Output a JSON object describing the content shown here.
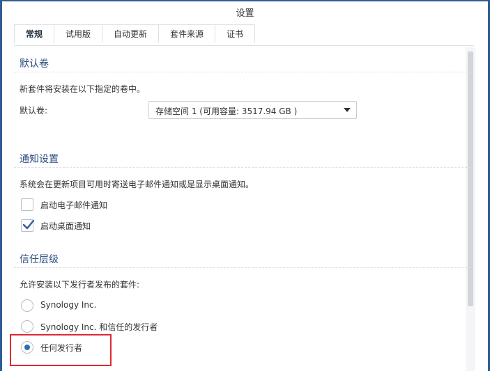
{
  "dialog": {
    "title": "设置"
  },
  "tabs": [
    {
      "label": "常规",
      "active": true
    },
    {
      "label": "试用版",
      "active": false
    },
    {
      "label": "自动更新",
      "active": false
    },
    {
      "label": "套件来源",
      "active": false
    },
    {
      "label": "证书",
      "active": false
    }
  ],
  "default_volume": {
    "section_title": "默认卷",
    "description": "新套件将安装在以下指定的卷中。",
    "field_label": "默认卷:",
    "selected_value": "存储空间 1 (可用容量:  3517.94 GB )"
  },
  "notifications": {
    "section_title": "通知设置",
    "description": "系统会在更新项目可用时寄送电子邮件通知或是显示桌面通知。",
    "options": [
      {
        "label": "启动电子邮件通知",
        "checked": false
      },
      {
        "label": "启动桌面通知",
        "checked": true
      }
    ]
  },
  "trust_level": {
    "section_title": "信任层级",
    "description": "允许安装以下发行者发布的套件:",
    "options": [
      {
        "label": "Synology Inc.",
        "selected": false
      },
      {
        "label": "Synology Inc. 和信任的发行者",
        "selected": false
      },
      {
        "label": "任何发行者",
        "selected": true
      }
    ]
  },
  "colors": {
    "frame": "#2f5d94",
    "section_title": "#2b4c7e",
    "radio_selected": "#2f6db5",
    "highlight": "#e0282d"
  }
}
